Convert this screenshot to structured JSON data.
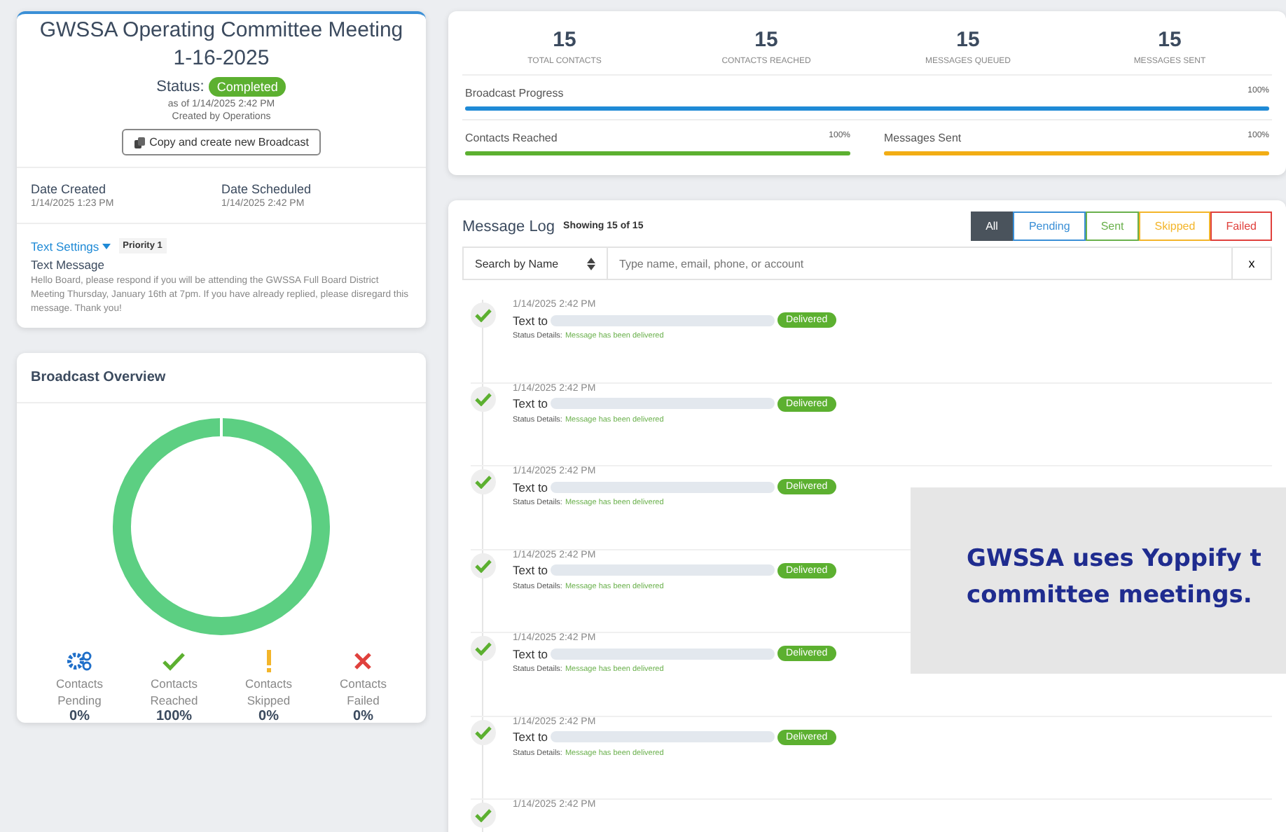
{
  "broadcast": {
    "title": "GWSSA Operating Committee Meeting 1-16-2025",
    "status_label": "Status:",
    "status": "Completed",
    "as_of": "as of 1/14/2025 2:42 PM",
    "created_by": "Created by Operations",
    "copy_button": "Copy and create new Broadcast",
    "dates": [
      {
        "label": "Date Created",
        "value": "1/14/2025 1:23 PM"
      },
      {
        "label": "Date Scheduled",
        "value": "1/14/2025 2:42 PM"
      }
    ],
    "settings_link": "Text Settings",
    "priority": "Priority 1",
    "message_label": "Text Message",
    "message": "Hello Board, please respond if you will be attending the GWSSA Full Board District Meeting Thursday, January 16th at 7pm. If you have already replied, please disregard this message. Thank you!"
  },
  "overview": {
    "title": "Broadcast Overview",
    "legend": [
      {
        "kind": "pending",
        "label": "Contacts Pending",
        "value": "0%"
      },
      {
        "kind": "reached",
        "label": "Contacts Reached",
        "value": "100%"
      },
      {
        "kind": "skipped",
        "label": "Contacts Skipped",
        "value": "0%"
      },
      {
        "kind": "failed",
        "label": "Contacts Failed",
        "value": "0%"
      }
    ]
  },
  "stats": [
    {
      "value": "15",
      "label": "TOTAL CONTACTS"
    },
    {
      "value": "15",
      "label": "CONTACTS REACHED"
    },
    {
      "value": "15",
      "label": "MESSAGES QUEUED"
    },
    {
      "value": "15",
      "label": "MESSAGES SENT"
    }
  ],
  "progress": [
    {
      "label": "Broadcast Progress",
      "reading": "100%",
      "level": 1,
      "color": "#1f8ad6"
    },
    {
      "label": "Contacts Reached",
      "reading": "100%",
      "level": 1,
      "color": "#5cb030"
    },
    {
      "label": "Messages Sent",
      "reading": "100%",
      "level": 1,
      "color": "#f2ad14"
    }
  ],
  "log": {
    "title": "Message Log",
    "count": "Showing 15 of 15",
    "filters": [
      {
        "label": "All",
        "selected": true,
        "color": "#4a535c"
      },
      {
        "label": "Pending",
        "selected": false,
        "color": "#3a8fd6"
      },
      {
        "label": "Sent",
        "selected": false,
        "color": "#6ab04c"
      },
      {
        "label": "Skipped",
        "selected": false,
        "color": "#f3b52a"
      },
      {
        "label": "Failed",
        "selected": false,
        "color": "#e0413d"
      }
    ],
    "search_by": "Search by Name",
    "search_placeholder": "Type name, email, phone, or account",
    "clear": "x",
    "messages": [
      {
        "time": "1/14/2025 2:42 PM",
        "text": "Text to",
        "status": "Delivered",
        "details_label": "Status Details:",
        "details": "Message has been delivered"
      },
      {
        "time": "1/14/2025 2:42 PM",
        "text": "Text to",
        "status": "Delivered",
        "details_label": "Status Details:",
        "details": "Message has been delivered"
      },
      {
        "time": "1/14/2025 2:42 PM",
        "text": "Text to",
        "status": "Delivered",
        "details_label": "Status Details:",
        "details": "Message has been delivered"
      },
      {
        "time": "1/14/2025 2:42 PM",
        "text": "Text to",
        "status": "Delivered",
        "details_label": "Status Details:",
        "details": "Message has been delivered"
      },
      {
        "time": "1/14/2025 2:42 PM",
        "text": "Text to",
        "status": "Delivered",
        "details_label": "Status Details:",
        "details": "Message has been delivered"
      },
      {
        "time": "1/14/2025 2:42 PM",
        "text": "Text to",
        "status": "Delivered",
        "details_label": "Status Details:",
        "details": "Message has been delivered"
      },
      {
        "time": "1/14/2025 2:42 PM"
      }
    ]
  },
  "caption": [
    "GWSSA uses Yoppify t",
    "committee meetings."
  ]
}
